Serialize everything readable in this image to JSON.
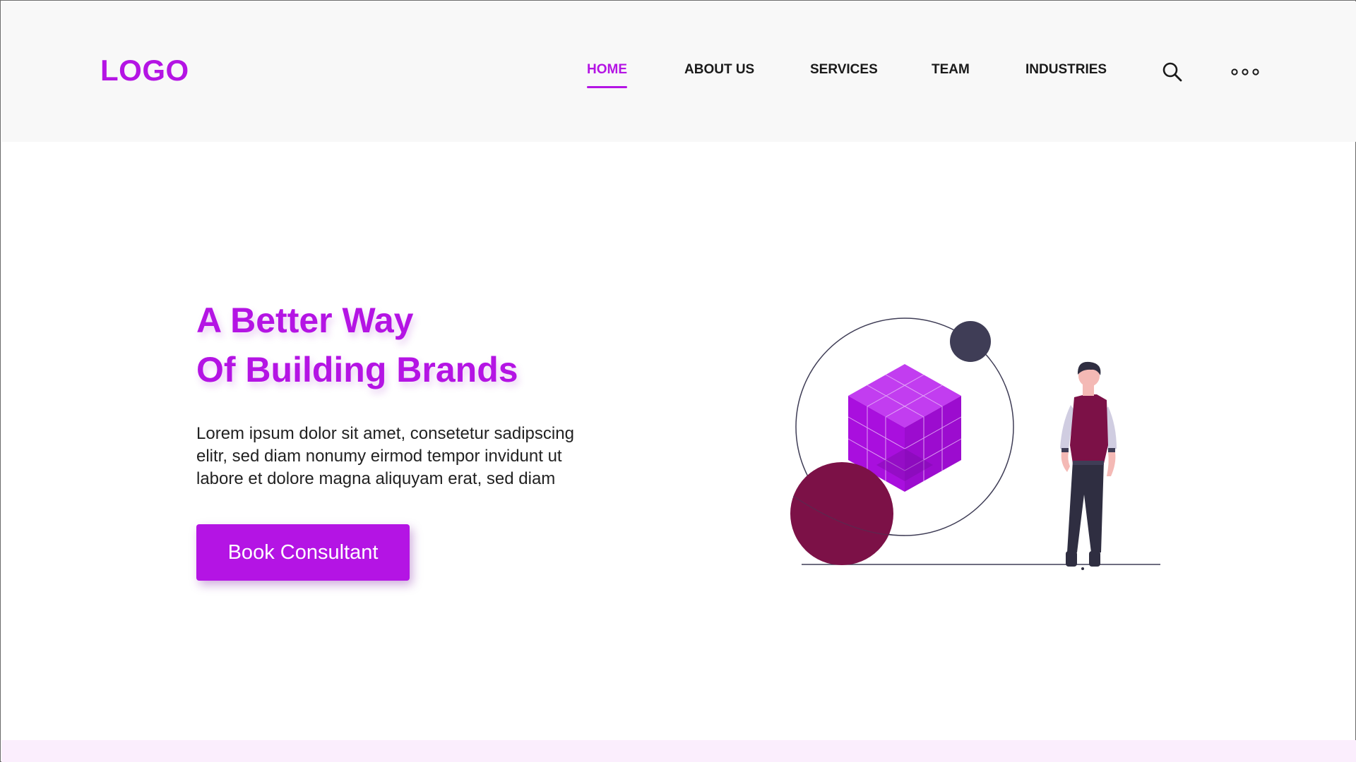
{
  "brand": {
    "logo": "LOGO",
    "accent_color": "#b414e4"
  },
  "nav": {
    "items": [
      {
        "label": "HOME",
        "active": true
      },
      {
        "label": "ABOUT US",
        "active": false
      },
      {
        "label": "SERVICES",
        "active": false
      },
      {
        "label": "TEAM",
        "active": false
      },
      {
        "label": "INDUSTRIES",
        "active": false
      }
    ],
    "icons": [
      "search-icon",
      "more-options-icon"
    ]
  },
  "hero": {
    "title_line1": "A Better Way",
    "title_line2": "Of Building Brands",
    "body_line1": "Lorem ipsum dolor sit amet, consetetur sadipscing",
    "body_line2": "elitr, sed diam nonumy eirmod tempor invidunt ut",
    "body_line3": "labore et dolore magna aliquyam erat, sed diam",
    "cta_label": "Book Consultant"
  },
  "illustration": {
    "colors": {
      "cube": "#b414e4",
      "sphere": "#7c1147",
      "small_orb": "#3f3d56",
      "person_vest": "#7c1147"
    }
  }
}
